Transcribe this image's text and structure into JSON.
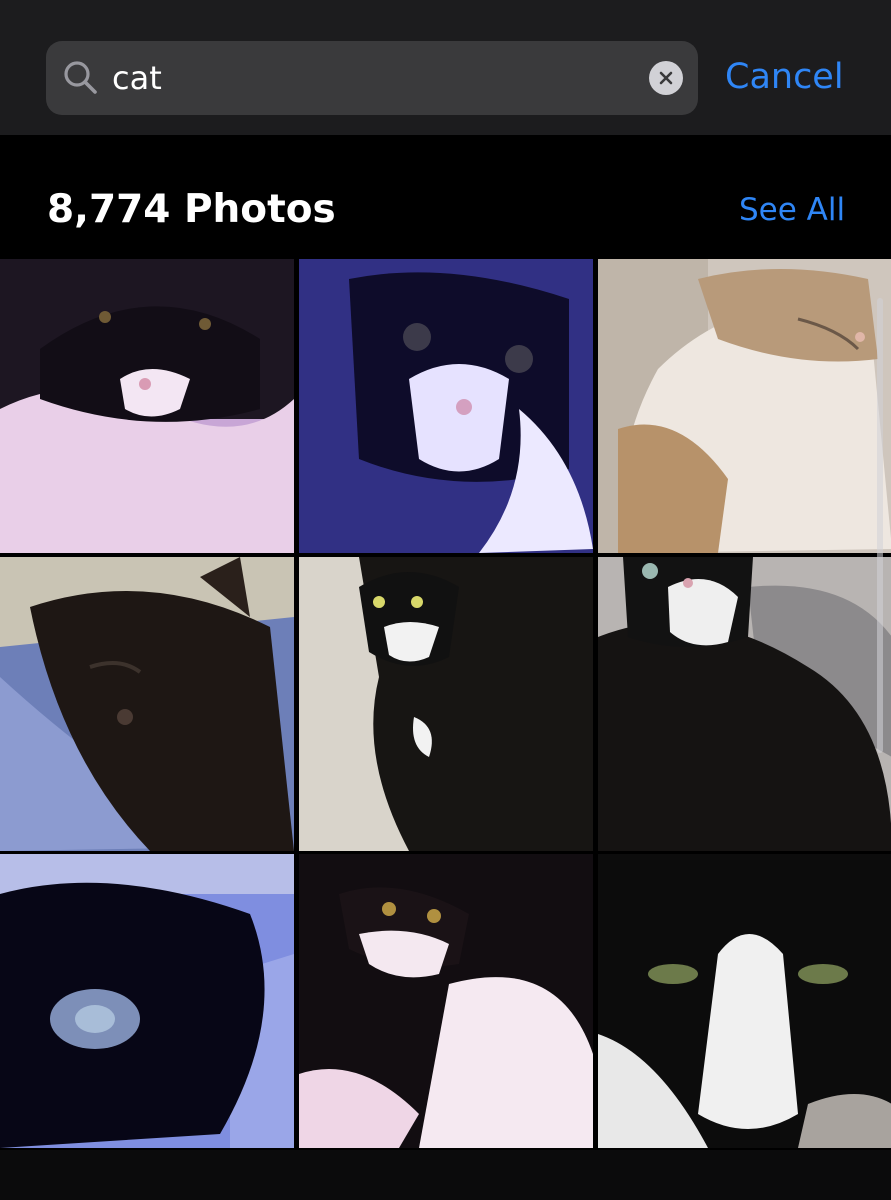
{
  "search": {
    "query": "cat",
    "cancel_label": "Cancel"
  },
  "results": {
    "count_label": "8,774 Photos",
    "see_all_label": "See All"
  },
  "photos": [
    {
      "subject": "black-and-white cat on pink blanket"
    },
    {
      "subject": "black-and-white cat under blue light"
    },
    {
      "subject": "calico cat sleeping"
    },
    {
      "subject": "black kitten sleeping on blue blanket"
    },
    {
      "subject": "tuxedo cat curled on knit blanket"
    },
    {
      "subject": "tuxedo cat looking up"
    },
    {
      "subject": "black cat close-up"
    },
    {
      "subject": "tuxedo cat with paws on pink blanket"
    },
    {
      "subject": "tuxedo cat close-up face"
    }
  ],
  "colors": {
    "accent": "#2f86f6",
    "header_bg": "#1c1c1e",
    "field_bg": "#3a3a3c"
  }
}
